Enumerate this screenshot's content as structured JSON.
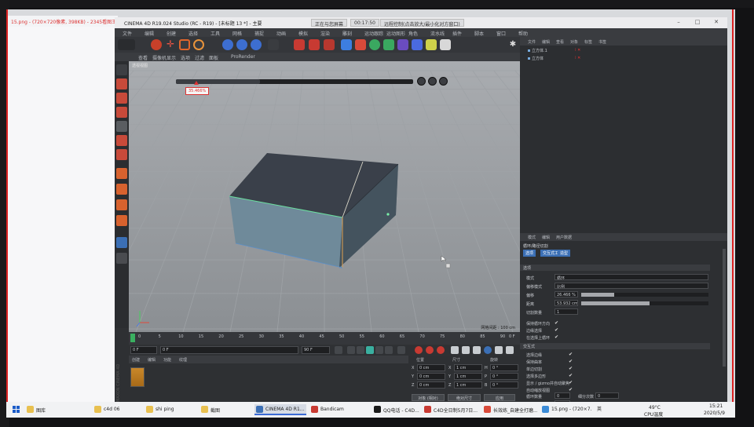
{
  "background_window": {
    "title": "15.png - (720×720像素, 398KB) - 2345看图王"
  },
  "c4d": {
    "title": "CINEMA 4D R19.024 Studio (RC - R19) - [未标题 13 *] - 主要",
    "title_pills": [
      "正在与您屏幕",
      "00:17:50",
      "远程控制(点击放大/最小化对方窗口)"
    ],
    "menu": [
      "文件",
      "编辑",
      "创建",
      "选择",
      "工具",
      "网格",
      "捕捉",
      "动画",
      "模拟",
      "渲染",
      "雕刻",
      "运动跟踪",
      "运动图形",
      "角色",
      "流水线",
      "插件",
      "脚本",
      "窗口",
      "帮助"
    ],
    "subbar": [
      "查看",
      "摄像机",
      "显示",
      "选项",
      "过滤",
      "面板",
      "ProRender"
    ],
    "viewport": {
      "label": "透视视图",
      "progress_percent": 35.46,
      "percent_label": "35.466%",
      "grid_scale": "网格间距 : 100 cm"
    },
    "timeline": {
      "ticks": [
        "0",
        "5",
        "10",
        "15",
        "20",
        "25",
        "30",
        "35",
        "40",
        "45",
        "50",
        "55",
        "60",
        "65",
        "70",
        "75",
        "80",
        "85",
        "90"
      ],
      "end_label": "0 F",
      "start_field": "0 F",
      "mid_field": "0 F",
      "range_field": "90 F",
      "end_field": "90 F"
    },
    "material_manager": {
      "menu": [
        "创建",
        "编辑",
        "功能",
        "纹理"
      ],
      "brand": "MAXON CINEMA 4D"
    },
    "coordinates": {
      "headers": [
        "位置",
        "尺寸",
        "旋转"
      ],
      "rows": [
        {
          "axis": "X",
          "pos": "0 cm",
          "size_axis": "X",
          "size": "1 cm",
          "rot_axis": "H",
          "rot": "0 °"
        },
        {
          "axis": "Y",
          "pos": "0 cm",
          "size_axis": "Y",
          "size": "1 cm",
          "rot_axis": "P",
          "rot": "0 °"
        },
        {
          "axis": "Z",
          "pos": "0 cm",
          "size_axis": "Z",
          "size": "1 cm",
          "rot_axis": "B",
          "rot": "0 °"
        }
      ],
      "mode": "对象 (相对)",
      "size_mode": "绝对尺寸",
      "apply": "应用"
    },
    "object_manager": {
      "menu": [
        "文件",
        "编辑",
        "查看",
        "对象",
        "标签",
        "书签"
      ],
      "objects": [
        "立方体.1",
        "立方体"
      ]
    },
    "attributes": {
      "menu": [
        "模式",
        "编辑",
        "用户数据"
      ],
      "tool": "循环/路径切割",
      "tabs": [
        "选项",
        "交互式工具",
        "造型"
      ],
      "section_options": "选项",
      "rows": [
        {
          "label": "模式",
          "value": "循环"
        },
        {
          "label": "偏移模式",
          "value": "比例"
        },
        {
          "label": "偏移",
          "value": "26.466 %",
          "fill": 0.26
        },
        {
          "label": "距离",
          "value": "53.932 cm",
          "fill": 0.54
        },
        {
          "label": "切割数量",
          "value": "1"
        }
      ],
      "checks": [
        "保持循环方向",
        "边缘选择",
        "在选择上循环"
      ],
      "section_interactive": "交互式",
      "checks2": [
        "选择边缘",
        "保持曲率",
        "单边切割",
        "选择多边形",
        "显示 / gizmo并自动聚焦",
        "自动缩放视图"
      ],
      "bottom_rows": [
        {
          "label": "循环数量",
          "value": "0",
          "label2": "细分次数",
          "value2": "0"
        },
        {
          "label": "启用细分区域",
          "value": "1"
        }
      ]
    }
  },
  "taskbar": {
    "items": [
      "图库",
      "c4d 06",
      "shi ping",
      "截图",
      "CINEMA 4D R1...",
      "Bandicam",
      "QQ电话 - C4D...",
      "C4D全日制5月7日...",
      "长效练_自建全打磨...",
      "15.png - (720×7..."
    ],
    "tray_temp": "49°C",
    "tray_cpu": "CPU温度",
    "ime": "英",
    "time": "15:21",
    "date": "2020/5/9"
  },
  "colors": {
    "accent_blue": "#3b6fb5",
    "selection_red": "#d22222",
    "edge_green": "#6be0a0",
    "edge_orange": "#e0a050"
  }
}
